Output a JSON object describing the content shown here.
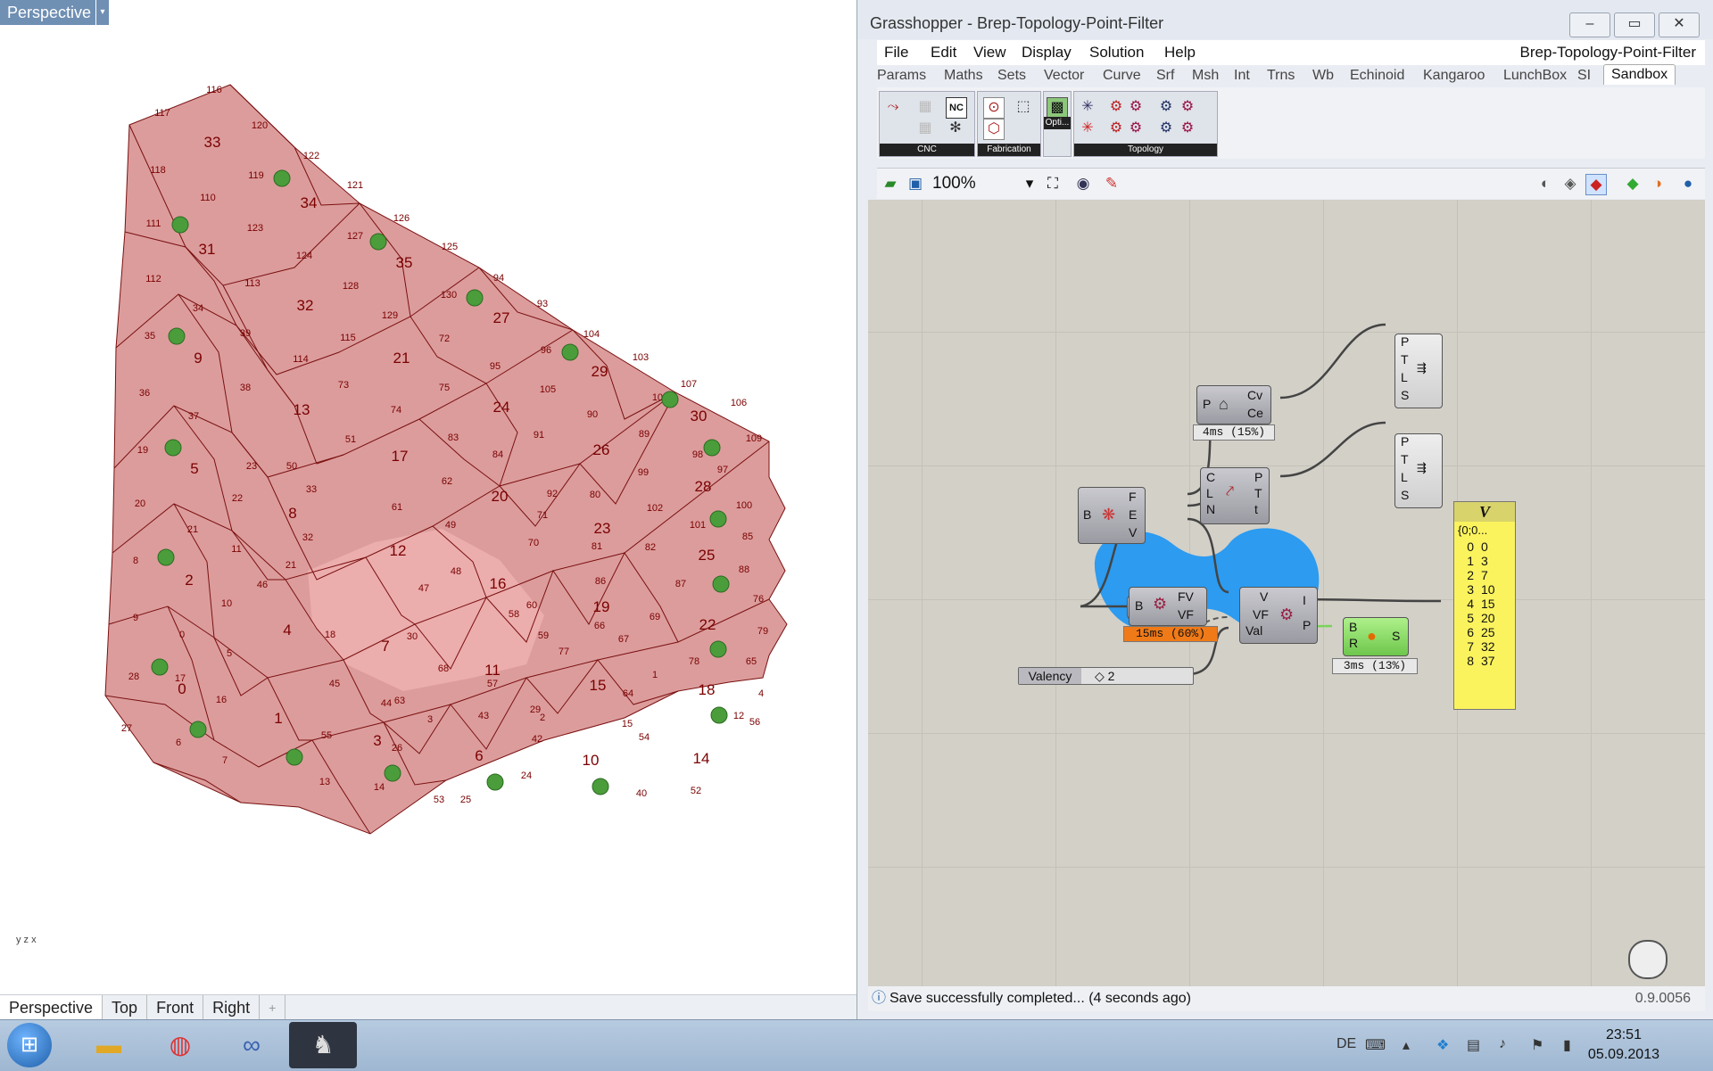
{
  "rhino": {
    "viewport_label": "Perspective",
    "viewport_menu_arrow": "▾",
    "axis_indicator": "y z x",
    "tabs": [
      "Perspective",
      "Top",
      "Front",
      "Right"
    ],
    "add_tab_icon": "+",
    "face_labels": [
      {
        "t": "33"
      },
      {
        "t": "34"
      },
      {
        "t": "31"
      },
      {
        "t": "35"
      },
      {
        "t": "32"
      },
      {
        "t": "27"
      },
      {
        "t": "9"
      },
      {
        "t": "21"
      },
      {
        "t": "29"
      },
      {
        "t": "13"
      },
      {
        "t": "24"
      },
      {
        "t": "30"
      },
      {
        "t": "5"
      },
      {
        "t": "17"
      },
      {
        "t": "26"
      },
      {
        "t": "28"
      },
      {
        "t": "8"
      },
      {
        "t": "20"
      },
      {
        "t": "23"
      },
      {
        "t": "25"
      },
      {
        "t": "2"
      },
      {
        "t": "12"
      },
      {
        "t": "16"
      },
      {
        "t": "19"
      },
      {
        "t": "22"
      },
      {
        "t": "4"
      },
      {
        "t": "7"
      },
      {
        "t": "11"
      },
      {
        "t": "15"
      },
      {
        "t": "18"
      },
      {
        "t": "0"
      },
      {
        "t": "1"
      },
      {
        "t": "3"
      },
      {
        "t": "6"
      },
      {
        "t": "10"
      },
      {
        "t": "14"
      }
    ],
    "edge_labels": [
      {
        "t": "116"
      },
      {
        "t": "117"
      },
      {
        "t": "120"
      },
      {
        "t": "122"
      },
      {
        "t": "118"
      },
      {
        "t": "119"
      },
      {
        "t": "121"
      },
      {
        "t": "110"
      },
      {
        "t": "111"
      },
      {
        "t": "123"
      },
      {
        "t": "127"
      },
      {
        "t": "126"
      },
      {
        "t": "125"
      },
      {
        "t": "124"
      },
      {
        "t": "112"
      },
      {
        "t": "113"
      },
      {
        "t": "128"
      },
      {
        "t": "130"
      },
      {
        "t": "94"
      },
      {
        "t": "93"
      },
      {
        "t": "34"
      },
      {
        "t": "129"
      },
      {
        "t": "104"
      },
      {
        "t": "35"
      },
      {
        "t": "39"
      },
      {
        "t": "115"
      },
      {
        "t": "72"
      },
      {
        "t": "96"
      },
      {
        "t": "103"
      },
      {
        "t": "114"
      },
      {
        "t": "95"
      },
      {
        "t": "107"
      },
      {
        "t": "36"
      },
      {
        "t": "38"
      },
      {
        "t": "73"
      },
      {
        "t": "75"
      },
      {
        "t": "105"
      },
      {
        "t": "108"
      },
      {
        "t": "106"
      },
      {
        "t": "37"
      },
      {
        "t": "74"
      },
      {
        "t": "90"
      },
      {
        "t": "89"
      },
      {
        "t": "109"
      },
      {
        "t": "19"
      },
      {
        "t": "23"
      },
      {
        "t": "51"
      },
      {
        "t": "83"
      },
      {
        "t": "91"
      },
      {
        "t": "98"
      },
      {
        "t": "97"
      },
      {
        "t": "50"
      },
      {
        "t": "84"
      },
      {
        "t": "99"
      },
      {
        "t": "33"
      },
      {
        "t": "62"
      },
      {
        "t": "92"
      },
      {
        "t": "22"
      },
      {
        "t": "20"
      },
      {
        "t": "80"
      },
      {
        "t": "102"
      },
      {
        "t": "100"
      },
      {
        "t": "61"
      },
      {
        "t": "71"
      },
      {
        "t": "101"
      },
      {
        "t": "21"
      },
      {
        "t": "49"
      },
      {
        "t": "85"
      },
      {
        "t": "11"
      },
      {
        "t": "32"
      },
      {
        "t": "70"
      },
      {
        "t": "82"
      },
      {
        "t": "8"
      },
      {
        "t": "81"
      },
      {
        "t": "88"
      },
      {
        "t": "21"
      },
      {
        "t": "48"
      },
      {
        "t": "86"
      },
      {
        "t": "87"
      },
      {
        "t": "46"
      },
      {
        "t": "76"
      },
      {
        "t": "9"
      },
      {
        "t": "10"
      },
      {
        "t": "47"
      },
      {
        "t": "60"
      },
      {
        "t": "58"
      },
      {
        "t": "79"
      },
      {
        "t": "0"
      },
      {
        "t": "69"
      },
      {
        "t": "66"
      },
      {
        "t": "5"
      },
      {
        "t": "18"
      },
      {
        "t": "59"
      },
      {
        "t": "67"
      },
      {
        "t": "78"
      },
      {
        "t": "65"
      },
      {
        "t": "17"
      },
      {
        "t": "30"
      },
      {
        "t": "68"
      },
      {
        "t": "77"
      },
      {
        "t": "1"
      },
      {
        "t": "28"
      },
      {
        "t": "45"
      },
      {
        "t": "57"
      },
      {
        "t": "64"
      },
      {
        "t": "4"
      },
      {
        "t": "16"
      },
      {
        "t": "63"
      },
      {
        "t": "29"
      },
      {
        "t": "44"
      },
      {
        "t": "43"
      },
      {
        "t": "2"
      },
      {
        "t": "12"
      },
      {
        "t": "27"
      },
      {
        "t": "55"
      },
      {
        "t": "3"
      },
      {
        "t": "15"
      },
      {
        "t": "56"
      },
      {
        "t": "6"
      },
      {
        "t": "26"
      },
      {
        "t": "42"
      },
      {
        "t": "54"
      },
      {
        "t": "7"
      },
      {
        "t": "13"
      },
      {
        "t": "14"
      },
      {
        "t": "24"
      },
      {
        "t": "40"
      },
      {
        "t": "52"
      },
      {
        "t": "53"
      },
      {
        "t": "25"
      },
      {
        "t": "41"
      }
    ],
    "filtered_points": 18
  },
  "gh": {
    "window_title": "Grasshopper - Brep-Topology-Point-Filter",
    "win_buttons": [
      "–",
      "▭",
      "✕"
    ],
    "menus": [
      "File",
      "Edit",
      "View",
      "Display",
      "Solution",
      "Help"
    ],
    "document_name": "Brep-Topology-Point-Filter",
    "tabs": [
      "Params",
      "Maths",
      "Sets",
      "Vector",
      "Curve",
      "Srf",
      "Msh",
      "Int",
      "Trns",
      "Wb",
      "Echinoid",
      "Kangaroo",
      "LunchBox",
      "SI",
      "Sandbox"
    ],
    "active_tab": "Sandbox",
    "ribbon_panels": [
      "CNC",
      "Fabrication",
      "Opti...",
      "Topology"
    ],
    "zoom": "100%",
    "status": "Save successfully completed... (4 seconds ago)",
    "version": "0.9.0056",
    "components": {
      "brep_pin": "B",
      "topo_outputs": [
        "F",
        "E",
        "V"
      ],
      "srf_in": "P",
      "srf_outputs": [
        "Cv",
        "Ce"
      ],
      "srf_badge": "4ms (15%)",
      "crv_inputs": [
        "C",
        "L",
        "N"
      ],
      "crv_outputs": [
        "P",
        "T",
        "t"
      ],
      "panel1_pins": [
        "P",
        "T",
        "L",
        "S"
      ],
      "panel2_pins": [
        "P",
        "T",
        "L",
        "S"
      ],
      "vf_in": "B",
      "vf_outputs": [
        "FV",
        "VF"
      ],
      "vf_badge": "15ms (60%)",
      "filter_inputs": [
        "V",
        "VF",
        "Val"
      ],
      "filter_outputs": [
        "I",
        "P"
      ],
      "slider_label": "Valency",
      "slider_value": "◇ 2",
      "preview_inputs": [
        "B",
        "R"
      ],
      "preview_output": "S",
      "preview_badge": "3ms (13%)"
    },
    "panel": {
      "title": "V",
      "path": "{0;0...",
      "rows": [
        {
          "i": "0",
          "v": "0"
        },
        {
          "i": "1",
          "v": "3"
        },
        {
          "i": "2",
          "v": "7"
        },
        {
          "i": "3",
          "v": "10"
        },
        {
          "i": "4",
          "v": "15"
        },
        {
          "i": "5",
          "v": "20"
        },
        {
          "i": "6",
          "v": "25"
        },
        {
          "i": "7",
          "v": "32"
        },
        {
          "i": "8",
          "v": "37"
        }
      ]
    }
  },
  "taskbar": {
    "apps": [
      "explorer",
      "chrome",
      "infinity",
      "rhino"
    ],
    "lang": "DE",
    "time": "23:51",
    "date": "05.09.2013"
  },
  "colors": {
    "surface_fill": "#d99b9b",
    "surface_stroke": "#7a1010",
    "point_fill": "#4a9d3a",
    "label": "#6b0000",
    "gh_blue_group": "#2c9bf0",
    "panel_yellow": "#fbf35e"
  }
}
